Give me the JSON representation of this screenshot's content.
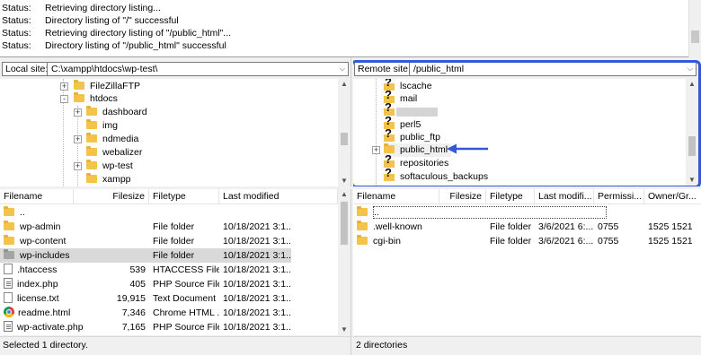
{
  "log": [
    {
      "label": "Status:",
      "text": "Retrieving directory listing..."
    },
    {
      "label": "Status:",
      "text": "Directory listing of \"/\" successful"
    },
    {
      "label": "Status:",
      "text": "Retrieving directory listing of \"/public_html\"..."
    },
    {
      "label": "Status:",
      "text": "Directory listing of \"/public_html\" successful"
    }
  ],
  "local": {
    "site_label": "Local site:",
    "path": "C:\\xampp\\htdocs\\wp-test\\",
    "tree": [
      "FileZillaFTP",
      "htdocs",
      "dashboard",
      "img",
      "ndmedia",
      "webalizer",
      "wp-test",
      "xampp"
    ],
    "columns": [
      "Filename",
      "Filesize",
      "Filetype",
      "Last modified"
    ],
    "files": [
      {
        "name": "..",
        "size": "",
        "type": "",
        "modified": ""
      },
      {
        "name": "wp-admin",
        "size": "",
        "type": "File folder",
        "modified": "10/18/2021 3:1..."
      },
      {
        "name": "wp-content",
        "size": "",
        "type": "File folder",
        "modified": "10/18/2021 3:1..."
      },
      {
        "name": "wp-includes",
        "size": "",
        "type": "File folder",
        "modified": "10/18/2021 3:1..."
      },
      {
        "name": ".htaccess",
        "size": "539",
        "type": "HTACCESS File",
        "modified": "10/18/2021 3:1..."
      },
      {
        "name": "index.php",
        "size": "405",
        "type": "PHP Source File",
        "modified": "10/18/2021 3:1..."
      },
      {
        "name": "license.txt",
        "size": "19,915",
        "type": "Text Document",
        "modified": "10/18/2021 3:1..."
      },
      {
        "name": "readme.html",
        "size": "7,346",
        "type": "Chrome HTML ...",
        "modified": "10/18/2021 3:1..."
      },
      {
        "name": "wp-activate.php",
        "size": "7,165",
        "type": "PHP Source File",
        "modified": "10/18/2021 3:1..."
      }
    ],
    "status": "Selected 1 directory."
  },
  "remote": {
    "site_label": "Remote site:",
    "path": "/public_html",
    "tree": [
      "lscache",
      "mail",
      "",
      "perl5",
      "public_ftp",
      "public_html",
      "repositories",
      "softaculous_backups"
    ],
    "columns": [
      "Filename",
      "Filesize",
      "Filetype",
      "Last modifi...",
      "Permissi...",
      "Owner/Gr..."
    ],
    "files": [
      {
        "name": "..",
        "size": "",
        "type": "",
        "modified": "",
        "perm": "",
        "owner": ""
      },
      {
        "name": ".well-known",
        "size": "",
        "type": "File folder",
        "modified": "3/6/2021 6:...",
        "perm": "0755",
        "owner": "1525 1521"
      },
      {
        "name": "cgi-bin",
        "size": "",
        "type": "File folder",
        "modified": "3/6/2021 6:...",
        "perm": "0755",
        "owner": "1525 1521"
      }
    ],
    "status": "2 directories"
  },
  "colors": {
    "highlight": "#3558d8",
    "arrow": "#3558d8",
    "folder": "#f4c34a"
  }
}
